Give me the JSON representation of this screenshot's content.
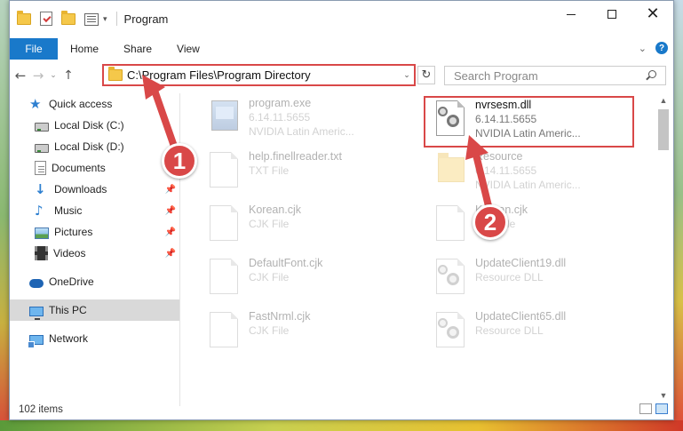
{
  "titlebar": {
    "title": "Program",
    "minimize_label": "",
    "maximize_label": "",
    "close_label": "✕"
  },
  "ribbon": {
    "tabs": [
      "File",
      "Home",
      "Share",
      "View"
    ],
    "help_label": "?"
  },
  "address": {
    "path": "C:\\Program Files\\Program Directory",
    "search_placeholder": "Search Program"
  },
  "sidebar": {
    "items": [
      {
        "label": "Quick access",
        "icon": "star-icon"
      },
      {
        "label": "Local Disk (C:)",
        "icon": "disk-icon"
      },
      {
        "label": "Local Disk (D:)",
        "icon": "disk-icon"
      },
      {
        "label": "Documents",
        "icon": "documents-icon"
      },
      {
        "label": "Downloads",
        "icon": "download-icon"
      },
      {
        "label": "Music",
        "icon": "music-icon"
      },
      {
        "label": "Pictures",
        "icon": "pictures-icon"
      },
      {
        "label": "Videos",
        "icon": "videos-icon"
      },
      {
        "label": "OneDrive",
        "icon": "cloud-icon"
      },
      {
        "label": "This PC",
        "icon": "pc-icon"
      },
      {
        "label": "Network",
        "icon": "network-icon"
      }
    ]
  },
  "files": [
    {
      "name": "program.exe",
      "line1": "6.14.11.5655",
      "line2": "NVIDIA Latin Americ..."
    },
    {
      "name": "nvrsesm.dll",
      "line1": "6.14.11.5655",
      "line2": "NVIDIA Latin Americ..."
    },
    {
      "name": "help.finellreader.txt",
      "line1": "TXT File",
      "line2": ""
    },
    {
      "name": "Resource",
      "line1": "6.14.11.5655",
      "line2": "NVIDIA Latin Americ..."
    },
    {
      "name": "Korean.cjk",
      "line1": "CJK File",
      "line2": ""
    },
    {
      "name": "Korean.cjk",
      "line1": "CJK File",
      "line2": ""
    },
    {
      "name": "DefaultFont.cjk",
      "line1": "CJK File",
      "line2": ""
    },
    {
      "name": "UpdateClient19.dll",
      "line1": "Resource DLL",
      "line2": ""
    },
    {
      "name": "FastNrml.cjk",
      "line1": "CJK File",
      "line2": ""
    },
    {
      "name": "UpdateClient65.dll",
      "line1": "Resource DLL",
      "line2": ""
    }
  ],
  "status": {
    "count": "102 items"
  },
  "annotations": {
    "marker1": "1",
    "marker2": "2",
    "color": "#d94848"
  }
}
